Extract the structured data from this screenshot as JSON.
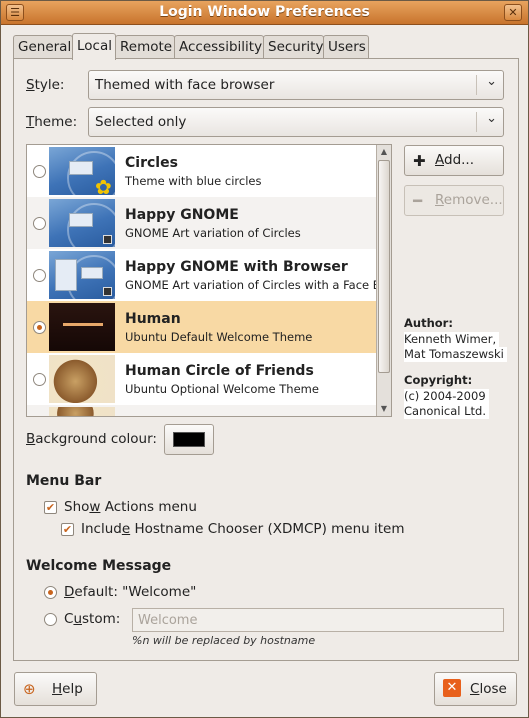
{
  "window": {
    "title": "Login Window Preferences"
  },
  "tabs": [
    "General",
    "Local",
    "Remote",
    "Accessibility",
    "Security",
    "Users"
  ],
  "active_tab": "Local",
  "style": {
    "label_pre": "",
    "label_u": "S",
    "label_post": "tyle:",
    "value": "Themed with face browser"
  },
  "theme": {
    "label_pre": "",
    "label_u": "T",
    "label_post": "heme:",
    "value": "Selected only"
  },
  "themes": [
    {
      "name": "Circles",
      "desc": "Theme with blue circles",
      "selected": false
    },
    {
      "name": "Happy GNOME",
      "desc": "GNOME Art variation of Circles",
      "selected": false
    },
    {
      "name": "Happy GNOME with Browser",
      "desc": "GNOME Art variation of Circles with a Face B",
      "selected": false
    },
    {
      "name": "Human",
      "desc": "Ubuntu Default Welcome Theme",
      "selected": true
    },
    {
      "name": "Human Circle of Friends",
      "desc": "Ubuntu Optional Welcome Theme",
      "selected": false
    }
  ],
  "buttons": {
    "add": {
      "pre": "",
      "u": "A",
      "post": "dd..."
    },
    "remove": {
      "pre": "",
      "u": "R",
      "post": "emove..."
    },
    "help": {
      "pre": "",
      "u": "H",
      "post": "elp"
    },
    "close": {
      "pre": "",
      "u": "C",
      "post": "lose"
    }
  },
  "info": {
    "author_label": "Author:",
    "author_line1": "Kenneth Wimer,",
    "author_line2": "Mat Tomaszewski",
    "copyright_label": "Copyright:",
    "copyright_line1": "(c) 2004-2009",
    "copyright_line2": "Canonical Ltd."
  },
  "background": {
    "pre": "",
    "u": "B",
    "post": "ackground colour:",
    "color": "#000000"
  },
  "menu_bar": {
    "heading": "Menu Bar",
    "show_actions": {
      "pre": "Sho",
      "u": "w",
      "post": " Actions menu",
      "checked": true
    },
    "include_hostname": {
      "pre": "Includ",
      "u": "e",
      "post": " Hostname Chooser (XDMCP) menu item",
      "checked": true
    }
  },
  "welcome": {
    "heading": "Welcome Message",
    "default": {
      "pre": "",
      "u": "D",
      "post": "efault: \"Welcome\"",
      "selected": true
    },
    "custom": {
      "pre": "C",
      "u": "u",
      "post": "stom:",
      "selected": false
    },
    "custom_placeholder": "Welcome",
    "hint": "%n will be replaced by hostname"
  },
  "colors": {
    "accent": "#c8641e",
    "titlebar": "#dd914a",
    "selected_row": "#f8d9a4"
  }
}
